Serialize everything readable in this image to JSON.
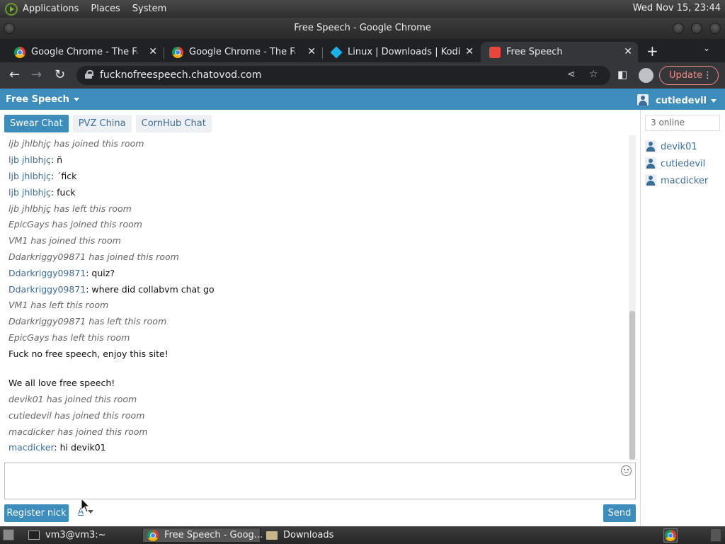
{
  "desktop": {
    "menus": [
      "Applications",
      "Places",
      "System"
    ],
    "clock": "Wed Nov 15, 23:44"
  },
  "window": {
    "title": "Free Speech - Google Chrome"
  },
  "browser": {
    "tabs": [
      {
        "label": "Google Chrome - The Fast & Secure",
        "icon": "chrome-icon"
      },
      {
        "label": "Google Chrome - The Fast & Secure",
        "icon": "chrome-icon"
      },
      {
        "label": "Linux | Downloads | Kodi",
        "icon": "kodi-icon"
      },
      {
        "label": "Free Speech",
        "icon": "chatovod-icon"
      }
    ],
    "url": "fucknofreespeech.chatovod.com",
    "update_label": "Update"
  },
  "chat": {
    "room_title": "Free Speech",
    "current_user": "cutiedevil",
    "rooms": [
      "Swear Chat",
      "PVZ China",
      "CornHub Chat"
    ],
    "messages": [
      {
        "type": "system",
        "text": "ljb jhlbhjç has joined this room"
      },
      {
        "type": "chat",
        "nick": "ljb jhlbhjç",
        "text": ": ñ"
      },
      {
        "type": "chat",
        "nick": "ljb jhlbhjç",
        "text": ": ´fick"
      },
      {
        "type": "chat",
        "nick": "ljb jhlbhjç",
        "text": ": fuck"
      },
      {
        "type": "system",
        "text": "ljb jhlbhjç has left this room"
      },
      {
        "type": "system",
        "text": "EpicGays has joined this room"
      },
      {
        "type": "system",
        "text": "VM1 has joined this room"
      },
      {
        "type": "system",
        "text": "Ddarkriggy09871 has joined this room"
      },
      {
        "type": "chat",
        "nick": "Ddarkriggy09871",
        "text": ": quiz?"
      },
      {
        "type": "chat",
        "nick": "Ddarkriggy09871",
        "text": ": where did collabvm chat go"
      },
      {
        "type": "system",
        "text": "VM1 has left this room"
      },
      {
        "type": "system",
        "text": "Ddarkriggy09871 has left this room"
      },
      {
        "type": "system",
        "text": "EpicGays has left this room"
      },
      {
        "type": "notice",
        "text": "Fuck no free speech, enjoy this site!"
      },
      {
        "type": "notice",
        "text": "We all love free speech!"
      },
      {
        "type": "system",
        "text": "devik01 has joined this room"
      },
      {
        "type": "system",
        "text": "cutiedevil has joined this room"
      },
      {
        "type": "system",
        "text": "macdicker has joined this room"
      },
      {
        "type": "chat",
        "nick": "macdicker",
        "text": ": hi devik01"
      }
    ],
    "message_input": "",
    "register_label": "Register nick",
    "font_label": "A",
    "send_label": "Send",
    "online_count": "3 online",
    "users": [
      "devik01",
      "cutiedevil",
      "macdicker"
    ]
  },
  "taskbar": {
    "items": [
      "vm3@vm3:~",
      "Free Speech - Goog...",
      "Downloads"
    ]
  },
  "colors": {
    "accent": "#3c8dbc",
    "link": "#3c6e9c",
    "update": "#f28b82"
  }
}
